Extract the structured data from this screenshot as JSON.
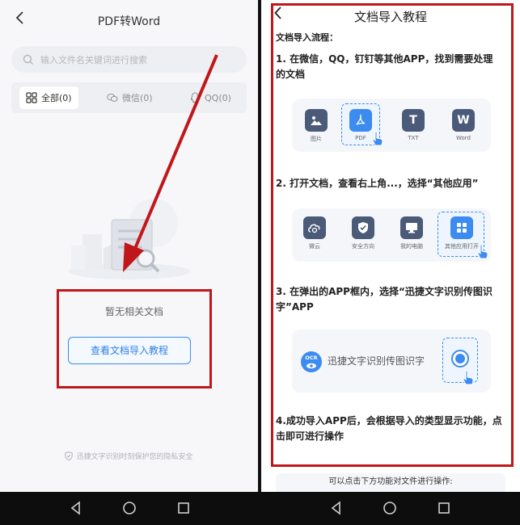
{
  "left": {
    "title": "PDF转Word",
    "search_placeholder": "输入文件名关键词进行搜索",
    "tabs": [
      {
        "label": "全部(0)"
      },
      {
        "label": "微信(0)"
      },
      {
        "label": "QQ(0)"
      }
    ],
    "empty_text": "暂无相关文档",
    "guide_button": "查看文档导入教程",
    "privacy_note": "迅捷文字识别时刻保护您的隐私安全"
  },
  "right": {
    "title": "文档导入教程",
    "flow_heading": "文档导入流程：",
    "steps": [
      {
        "text": "1. 在微信，QQ，钉钉等其他APP，找到需要处理的文档"
      },
      {
        "text": "2. 打开文档，查看右上角...，选择“其他应用”"
      },
      {
        "text": "3. 在弹出的APP框内，选择“迅捷文字识别传图识字”APP"
      },
      {
        "text": "4.成功导入APP后，会根据导入的类型显示功能，点击即可进行操作"
      }
    ],
    "file_types": [
      {
        "label": "图片",
        "glyph": "",
        "color": "#4a5a78"
      },
      {
        "label": "PDF",
        "glyph": "",
        "color": "#3b8bf0"
      },
      {
        "label": "TXT",
        "glyph": "T",
        "color": "#4a5a78"
      },
      {
        "label": "Word",
        "glyph": "W",
        "color": "#4a5a78"
      }
    ],
    "share_targets": [
      {
        "label": "微云",
        "color": "#4a5a78"
      },
      {
        "label": "安全方向",
        "color": "#4a5a78"
      },
      {
        "label": "我的电脑",
        "color": "#4a5a78"
      },
      {
        "label": "其他应用打开",
        "color": "#3b8bf0"
      }
    ],
    "ocr_logo_text": "OCR",
    "ocr_app_name": "迅捷文字识别传图识字",
    "bottom_note": "可以点击下方功能对文件进行操作:"
  },
  "colors": {
    "accent": "#3b8bf0",
    "annotation_red": "#c0171b"
  }
}
